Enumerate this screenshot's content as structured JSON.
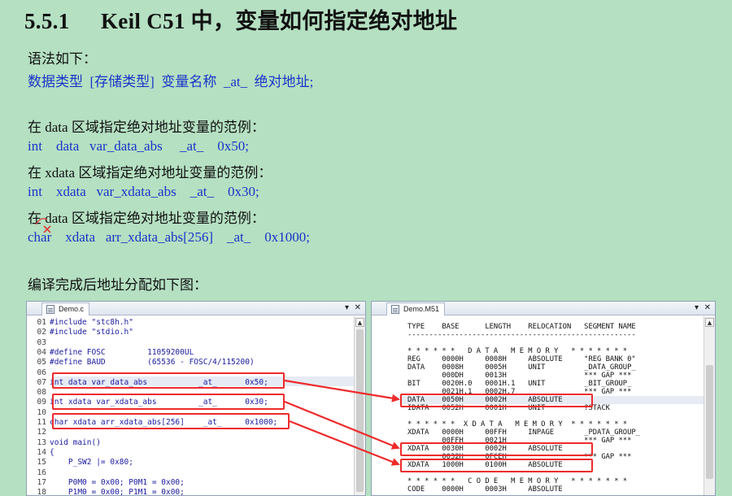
{
  "heading": {
    "number": "5.5.1",
    "title": "Keil C51 中，变量如何指定绝对地址"
  },
  "syntax_label": "语法如下：",
  "syntax": "数据类型  [存储类型]  变量名称  _at_  绝对地址;",
  "examples": [
    {
      "label": "在 data 区域指定绝对地址变量的范例：",
      "code": "int    data   var_data_abs     _at_    0x50;"
    },
    {
      "label": "在 xdata 区域指定绝对地址变量的范例：",
      "code": "int    xdata   var_xdata_abs    _at_    0x30;"
    },
    {
      "label": "在 data 区域指定绝对地址变量的范例：",
      "code": "char    xdata   arr_xdata_abs[256]    _at_    0x1000;"
    }
  ],
  "result_label": "编译完成后地址分配如下图：",
  "colors": {
    "background": "#b5e0c2",
    "text_blue": "#1a35c8",
    "highlight_box": "#ee2b2b"
  },
  "code_editor": {
    "tab": "Demo.c",
    "lines": [
      {
        "n": "01",
        "text": "#include \"stc8h.h\""
      },
      {
        "n": "02",
        "text": "#include \"stdio.h\""
      },
      {
        "n": "03",
        "text": ""
      },
      {
        "n": "04",
        "text": "#define FOSC         11059200UL"
      },
      {
        "n": "05",
        "text": "#define BAUD         (65536 - FOSC/4/115200)"
      },
      {
        "n": "06",
        "text": ""
      },
      {
        "n": "07",
        "text": "int data var_data_abs           _at_      0x50;"
      },
      {
        "n": "08",
        "text": ""
      },
      {
        "n": "09",
        "text": "int xdata var_xdata_abs         _at_      0x30;"
      },
      {
        "n": "10",
        "text": ""
      },
      {
        "n": "11",
        "text": "char xdata arr_xdata_abs[256]    _at_     0x1000;"
      },
      {
        "n": "12",
        "text": ""
      },
      {
        "n": "13",
        "text": "void main()"
      },
      {
        "n": "14",
        "text": "{"
      },
      {
        "n": "15",
        "text": "    P_SW2 |= 0x80;"
      },
      {
        "n": "16",
        "text": ""
      },
      {
        "n": "17",
        "text": "    P0M0 = 0x00; P0M1 = 0x00;"
      },
      {
        "n": "18",
        "text": "    P1M0 = 0x00; P1M1 = 0x00;"
      }
    ]
  },
  "map_viewer": {
    "tab": "Demo.M51",
    "lines": [
      "TYPE    BASE      LENGTH    RELOCATION   SEGMENT NAME",
      "-----------------------------------------------------",
      "",
      "* * * * * *   D A T A   M E M O R Y   * * * * * * *",
      "REG     0000H     0008H     ABSOLUTE     \"REG BANK 0\"",
      "DATA    0008H     0005H     UNIT         _DATA_GROUP_",
      "        000DH     0013H                  *** GAP ***",
      "BIT     0020H.0   0001H.1   UNIT         _BIT_GROUP_",
      "        0021H.1   0002H.7                *** GAP ***",
      "DATA    0050H     0002H     ABSOLUTE",
      "IDATA   0052H     0001H     UNIT         ?STACK",
      "",
      "* * * * * *  X D A T A   M E M O R Y  * * * * * * *",
      "XDATA   0000H     00FFH     INPAGE       _PDATA_GROUP_",
      "        00FFH     0021H                  *** GAP ***",
      "XDATA   0030H     0002H     ABSOLUTE",
      "        0032H     0FCEH                  *** GAP ***",
      "XDATA   1000H     0100H     ABSOLUTE",
      "",
      "* * * * * *   C O D E   M E M O R Y   * * * * * * *",
      "CODE    0000H     0003H     ABSOLUTE"
    ]
  }
}
